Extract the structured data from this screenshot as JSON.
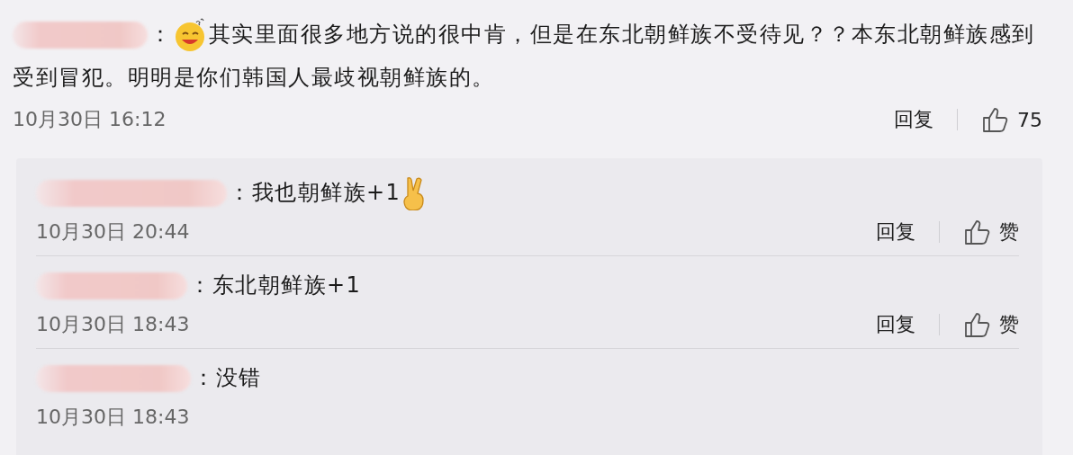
{
  "comment": {
    "content": [
      {
        "kind": "text",
        "text": "："
      },
      {
        "kind": "grin"
      },
      {
        "kind": "text",
        "text": "其实里面很多地方说的很中肯，但是在东北朝鲜族不受待见？？本东北朝鲜族感到"
      },
      {
        "kind": "line",
        "text": "受到冒犯。明明是你们韩国人最歧视朝鲜族的。"
      }
    ],
    "date": "10月30日 16:12",
    "reply_label": "回复",
    "like_label": "75"
  },
  "replies": [
    {
      "content": [
        {
          "kind": "text",
          "text": "：我也朝鲜族+1"
        },
        {
          "kind": "victory"
        }
      ],
      "date": "10月30日 20:44",
      "reply_label": "回复",
      "like_label": "赞"
    },
    {
      "content": [
        {
          "kind": "text",
          "text": "：东北朝鲜族+1"
        }
      ],
      "date": "10月30日 18:43",
      "reply_label": "回复",
      "like_label": "赞"
    },
    {
      "content": [
        {
          "kind": "text",
          "text": "：没错"
        }
      ],
      "date": "10月30日 18:43"
    }
  ]
}
